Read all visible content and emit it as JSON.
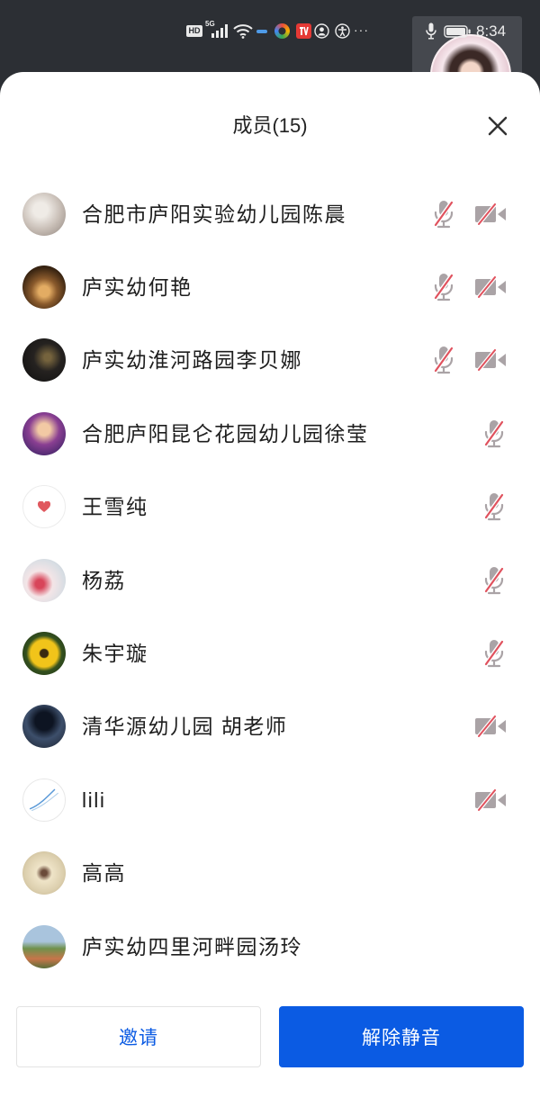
{
  "status_bar": {
    "hd_label": "HD",
    "network_label": "5G",
    "more_label": "···",
    "time": "8:34",
    "icons": [
      "signal-icon",
      "wifi-icon",
      "app-indicator-icon",
      "app-icon",
      "video-app-icon",
      "person-icon",
      "accessibility-icon",
      "mic-icon",
      "battery-icon"
    ]
  },
  "panel": {
    "title": "成员(15)",
    "close_icon": "close-icon"
  },
  "members": [
    {
      "name": "合肥市庐阳实验幼儿园陈晨",
      "status_icons": [
        "mic-muted-icon",
        "camera-off-icon"
      ]
    },
    {
      "name": "庐实幼何艳",
      "status_icons": [
        "mic-muted-icon",
        "camera-off-icon"
      ]
    },
    {
      "name": "庐实幼淮河路园李贝娜",
      "status_icons": [
        "mic-muted-icon",
        "camera-off-icon"
      ]
    },
    {
      "name": "合肥庐阳昆仑花园幼儿园徐莹",
      "status_icons": [
        "mic-muted-icon"
      ]
    },
    {
      "name": "王雪纯",
      "status_icons": [
        "mic-muted-icon"
      ]
    },
    {
      "name": "杨荔",
      "status_icons": [
        "mic-muted-icon"
      ]
    },
    {
      "name": "朱宇璇",
      "status_icons": [
        "mic-muted-icon"
      ]
    },
    {
      "name": "清华源幼儿园 胡老师",
      "status_icons": [
        "camera-off-icon"
      ]
    },
    {
      "name": "lili",
      "status_icons": [
        "camera-off-icon"
      ]
    },
    {
      "name": "高高",
      "status_icons": []
    },
    {
      "name": "庐实幼四里河畔园汤玲",
      "status_icons": []
    }
  ],
  "actions": {
    "invite_label": "邀请",
    "unmute_label": "解除静音"
  },
  "colors": {
    "accent": "#0b5be3",
    "muted_slash": "#e0525e",
    "icon_gray": "#aaa3a6",
    "status_bar_bg": "#2c2f34",
    "sheet_bg": "#ffffff"
  }
}
